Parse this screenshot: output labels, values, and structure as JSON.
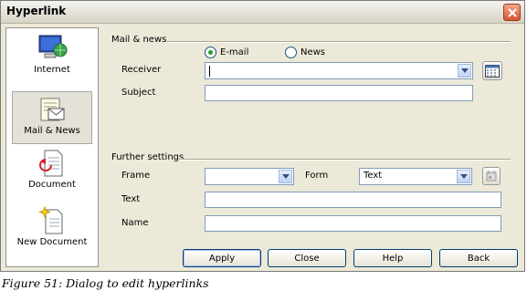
{
  "window": {
    "title": "Hyperlink"
  },
  "sidebar": {
    "items": [
      {
        "label": "Internet"
      },
      {
        "label": "Mail & News"
      },
      {
        "label": "Document"
      },
      {
        "label": "New Document"
      }
    ],
    "selected": "Mail & News"
  },
  "mail_news": {
    "heading": "Mail & news",
    "radio_email": "E-mail",
    "radio_news": "News",
    "selected_type": "E-mail",
    "receiver_label": "Receiver",
    "receiver_value": "",
    "subject_label": "Subject",
    "subject_value": ""
  },
  "further": {
    "heading": "Further settings",
    "frame_label": "Frame",
    "frame_value": "",
    "form_label": "Form",
    "form_value": "Text",
    "text_label": "Text",
    "text_value": "",
    "name_label": "Name",
    "name_value": ""
  },
  "buttons": {
    "apply": "Apply",
    "close": "Close",
    "help": "Help",
    "back": "Back"
  },
  "caption": "Figure 51: Dialog to edit hyperlinks",
  "icons": [
    "close-icon",
    "internet-icon",
    "mail-news-icon",
    "document-icon",
    "new-document-icon",
    "data-sources-icon",
    "events-icon",
    "dropdown-arrow-icon"
  ]
}
